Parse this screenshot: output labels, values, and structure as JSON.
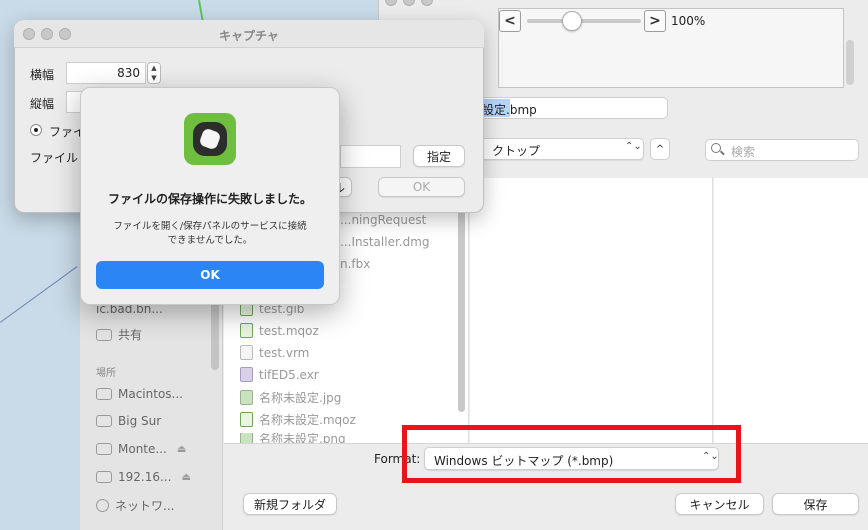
{
  "viewer": {
    "zoom": "100%",
    "prev_glyph": "<",
    "next_glyph": ">"
  },
  "capture": {
    "title": "キャプチャ",
    "width_label": "横幅",
    "width_value": "830",
    "height_label": "縦幅",
    "radio_label": "ファイ",
    "file_label": "ファイル",
    "specify_button": "指定",
    "cancel_button": "ル",
    "ok_button": "OK"
  },
  "alert": {
    "title": "ファイルの保存操作に失敗しました。",
    "message_line1": "ファイルを開く/保存パネルのサービスに接続",
    "message_line2": "できませんでした。",
    "ok_button": "OK"
  },
  "save_panel": {
    "filename_prefix": "設定",
    "filename_suffix": ".bmp",
    "location": "、クトップ",
    "location_caret": "⌃⌄",
    "expand_glyph": "^",
    "search_placeholder": "検索",
    "format_label": "Format:",
    "format_value": "Windows ビットマップ (*.bmp)",
    "format_caret": "⌃⌄",
    "new_folder_button": "新規フォルダ",
    "cancel_button": "キャンセル",
    "save_button": "保存",
    "sidebar": {
      "partial_item": "ic.bad.bn...",
      "shared": "共有",
      "locations_header": "場所",
      "locations": [
        {
          "label": "Macintos...",
          "eject": ""
        },
        {
          "label": "Big Sur",
          "eject": ""
        },
        {
          "label": "Monte...",
          "eject": "⏏"
        },
        {
          "label": "192.16...",
          "eject": "⏏"
        },
        {
          "label": "ネットワ...",
          "eject": ""
        }
      ]
    },
    "files": [
      {
        "name": "...ningRequest",
        "kind": "doc"
      },
      {
        "name": "...Installer.dmg",
        "kind": "doc"
      },
      {
        "name": "n.fbx",
        "kind": "doc"
      },
      {
        "name": "test.gib",
        "kind": "grn"
      },
      {
        "name": "test.mqoz",
        "kind": "grn"
      },
      {
        "name": "test.vrm",
        "kind": "blank"
      },
      {
        "name": "tifED5.exr",
        "kind": "doc"
      },
      {
        "name": "名称未設定.jpg",
        "kind": "img"
      },
      {
        "name": "名称未設定.mqoz",
        "kind": "grn"
      },
      {
        "name": "名称未設定.png",
        "kind": "img"
      }
    ]
  },
  "colors": {
    "accent": "#2b85f5",
    "highlight_box": "#e6151a",
    "app_icon_green": "#6fbe3f"
  }
}
